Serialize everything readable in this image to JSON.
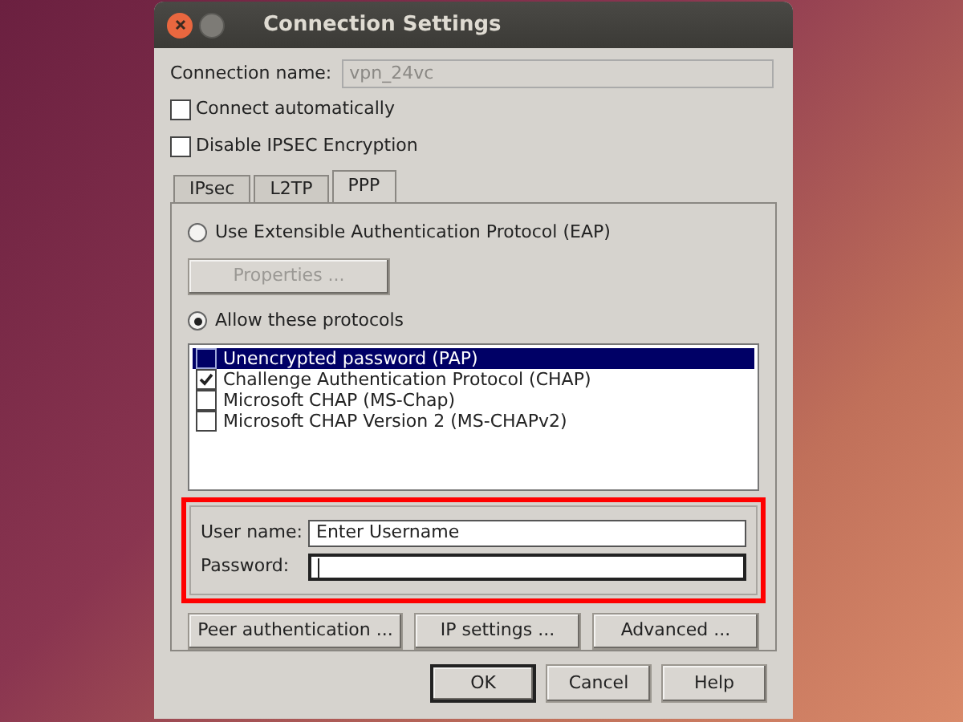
{
  "window": {
    "title": "Connection Settings"
  },
  "connection_name": {
    "label": "Connection name:",
    "value": "vpn_24vc",
    "disabled": true
  },
  "options": [
    {
      "label": "Connect automatically",
      "checked": false
    },
    {
      "label": "Disable IPSEC Encryption",
      "checked": false
    }
  ],
  "tabs": [
    {
      "label": "IPsec",
      "selected": false
    },
    {
      "label": "L2TP",
      "selected": false
    },
    {
      "label": "PPP",
      "selected": true
    }
  ],
  "auth_modes": [
    {
      "label": "Use Extensible Authentication Protocol (EAP)",
      "selected": false
    },
    {
      "label": "Allow these protocols",
      "selected": true
    }
  ],
  "properties_button": {
    "label": "Properties ...",
    "disabled": true
  },
  "protocols": [
    {
      "label": "Unencrypted password (PAP)",
      "checked": false,
      "selected": true
    },
    {
      "label": "Challenge Authentication Protocol (CHAP)",
      "checked": true,
      "selected": false
    },
    {
      "label": "Microsoft CHAP (MS-Chap)",
      "checked": false,
      "selected": false
    },
    {
      "label": "Microsoft CHAP Version 2 (MS-CHAPv2)",
      "checked": false,
      "selected": false
    }
  ],
  "credentials": {
    "highlighted": true,
    "fields": [
      {
        "label": "User name:",
        "value": "Enter Username",
        "focused": false
      },
      {
        "label": "Password:",
        "focused": true
      }
    ]
  },
  "tab_buttons": [
    "Peer authentication ...",
    "IP settings ...",
    "Advanced ..."
  ],
  "dialog_buttons": [
    {
      "label": "OK",
      "default": true
    },
    {
      "label": "Cancel",
      "default": false
    },
    {
      "label": "Help",
      "default": false
    }
  ]
}
